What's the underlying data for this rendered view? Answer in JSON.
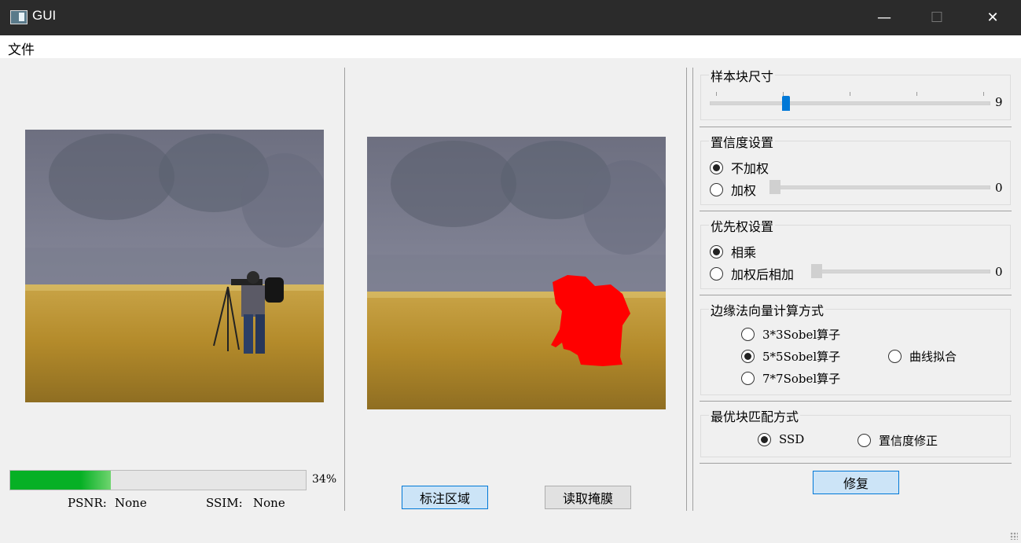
{
  "window": {
    "title": "GUI",
    "minimize_glyph": "—",
    "maximize_glyph": "☐",
    "close_glyph": "✕"
  },
  "menu": {
    "file": "文件"
  },
  "left": {
    "progress_value": 0.34,
    "progress_label": "34%",
    "psnr_label": "PSNR:",
    "psnr_value": "None",
    "ssim_label": "SSIM:",
    "ssim_value": "None"
  },
  "middle": {
    "mark_region_button": "标注区域",
    "read_mask_button": "读取掩膜"
  },
  "right": {
    "patch_size": {
      "title": "样本块尺寸",
      "value": "9",
      "level": 0.25
    },
    "confidence": {
      "title": "置信度设置",
      "option1": "不加权",
      "option2": "加权",
      "value": "0",
      "level": 0
    },
    "priority": {
      "title": "优先权设置",
      "option1": "相乘",
      "option2": "加权后相加",
      "value": "0",
      "level": 0
    },
    "edge_normal": {
      "title": "边缘法向量计算方式",
      "option1": "3*3Sobel算子",
      "option2": "5*5Sobel算子",
      "option3": "7*7Sobel算子",
      "option4": "曲线拟合"
    },
    "best_match": {
      "title": "最优块匹配方式",
      "option1": "SSD",
      "option2": "置信度修正"
    },
    "repair_button": "修复"
  },
  "colors": {
    "accent": "#0078d7",
    "progress": "#06b025",
    "mask": "#ff0000"
  }
}
